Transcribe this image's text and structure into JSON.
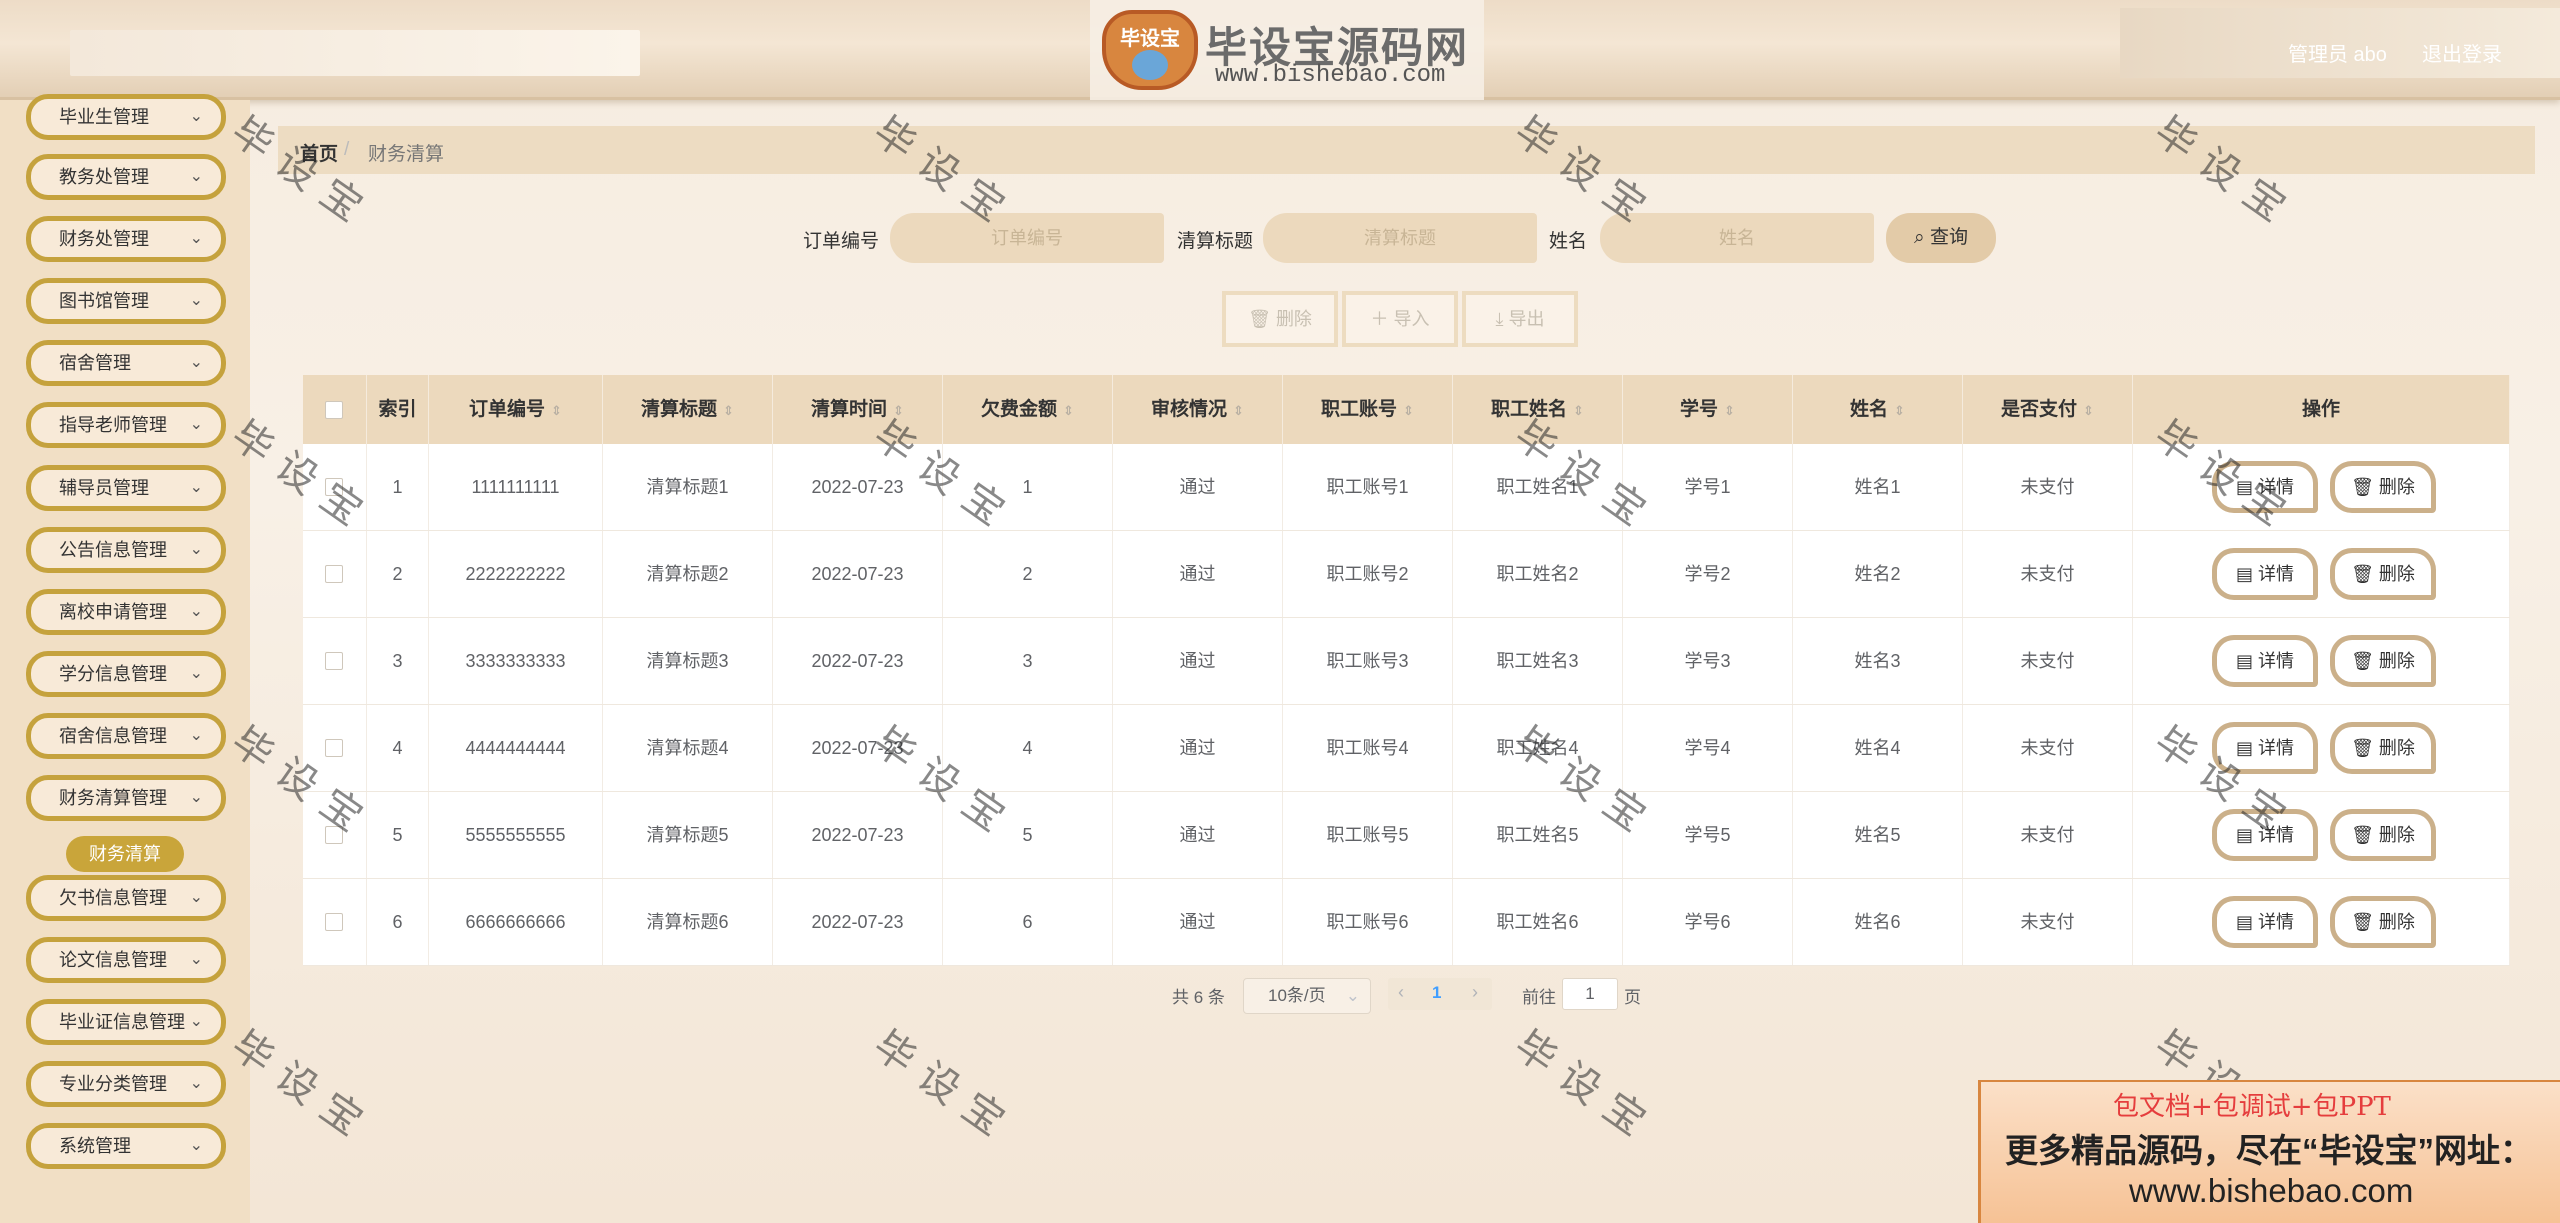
{
  "header": {
    "logo_badge": "毕设宝",
    "logo_title": "毕设宝源码网",
    "logo_url": "www.bishebao.com",
    "user": "管理员 abo",
    "logout": "退出登录"
  },
  "sidebar": {
    "items": [
      {
        "label": "毕业生管理"
      },
      {
        "label": "教务处管理"
      },
      {
        "label": "财务处管理"
      },
      {
        "label": "图书馆管理"
      },
      {
        "label": "宿舍管理"
      },
      {
        "label": "指导老师管理"
      },
      {
        "label": "辅导员管理"
      },
      {
        "label": "公告信息管理"
      },
      {
        "label": "离校申请管理"
      },
      {
        "label": "学分信息管理"
      },
      {
        "label": "宿舍信息管理"
      },
      {
        "label": "财务清算管理"
      },
      {
        "label": "欠书信息管理"
      },
      {
        "label": "论文信息管理"
      },
      {
        "label": "毕业证信息管理"
      },
      {
        "label": "专业分类管理"
      },
      {
        "label": "系统管理"
      }
    ],
    "active_sub": "财务清算"
  },
  "breadcrumb": {
    "home": "首页",
    "sep": "/",
    "current": "财务清算"
  },
  "search": {
    "fields": [
      {
        "label": "订单编号",
        "placeholder": "订单编号"
      },
      {
        "label": "清算标题",
        "placeholder": "清算标题"
      },
      {
        "label": "姓名",
        "placeholder": "姓名"
      }
    ],
    "button": "查询"
  },
  "actions": {
    "delete": "删除",
    "import": "导入",
    "export": "导出"
  },
  "table": {
    "headers": [
      "索引",
      "订单编号",
      "清算标题",
      "清算时间",
      "欠费金额",
      "审核情况",
      "职工账号",
      "职工姓名",
      "学号",
      "姓名",
      "是否支付",
      "操作"
    ],
    "rows": [
      [
        "1",
        "1111111111",
        "清算标题1",
        "2022-07-23",
        "1",
        "通过",
        "职工账号1",
        "职工姓名1",
        "学号1",
        "姓名1",
        "未支付"
      ],
      [
        "2",
        "2222222222",
        "清算标题2",
        "2022-07-23",
        "2",
        "通过",
        "职工账号2",
        "职工姓名2",
        "学号2",
        "姓名2",
        "未支付"
      ],
      [
        "3",
        "3333333333",
        "清算标题3",
        "2022-07-23",
        "3",
        "通过",
        "职工账号3",
        "职工姓名3",
        "学号3",
        "姓名3",
        "未支付"
      ],
      [
        "4",
        "4444444444",
        "清算标题4",
        "2022-07-23",
        "4",
        "通过",
        "职工账号4",
        "职工姓名4",
        "学号4",
        "姓名4",
        "未支付"
      ],
      [
        "5",
        "5555555555",
        "清算标题5",
        "2022-07-23",
        "5",
        "通过",
        "职工账号5",
        "职工姓名5",
        "学号5",
        "姓名5",
        "未支付"
      ],
      [
        "6",
        "6666666666",
        "清算标题6",
        "2022-07-23",
        "6",
        "通过",
        "职工账号6",
        "职工姓名6",
        "学号6",
        "姓名6",
        "未支付"
      ]
    ],
    "op_detail": "详情",
    "op_delete": "删除"
  },
  "pagination": {
    "total": "共 6 条",
    "page_size": "10条/页",
    "current_page": "1",
    "goto_label": "前往",
    "goto_value": "1",
    "unit": "页"
  },
  "watermark": "毕设宝",
  "promo": {
    "line1": "包文档+包调试+包PPT",
    "line2": "更多精品源码，尽在“毕设宝”网址：",
    "line3": "www.bishebao.com"
  }
}
